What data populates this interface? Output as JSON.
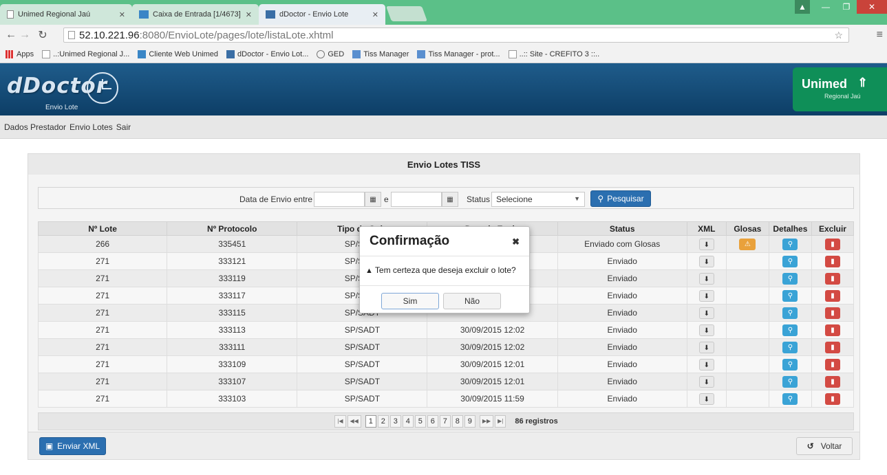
{
  "browser": {
    "tabs": [
      {
        "label": "Unimed Regional Jaú",
        "active": false
      },
      {
        "label": "Caixa de Entrada [1/4673]",
        "active": false
      },
      {
        "label": "dDoctor - Envio Lote",
        "active": true
      }
    ],
    "url_host": "52.10.221.96",
    "url_path": ":8080/EnvioLote/pages/lote/listaLote.xhtml",
    "bookmarks": [
      "Apps",
      "..:Unimed Regional J...",
      "Cliente Web Unimed",
      "dDoctor - Envio Lot...",
      "GED",
      "Tiss Manager",
      "Tiss Manager - prot...",
      "..:: Site - CREFITO 3 ::.."
    ]
  },
  "header": {
    "logo": "dDoctor",
    "logo_sub": "Envio Lote",
    "partner": "Unimed",
    "partner_sub": "Regional Jaú"
  },
  "menu": [
    "Dados Prestador",
    "Envio Lotes",
    "Sair"
  ],
  "panel": {
    "title": "Envio Lotes TISS",
    "filter": {
      "date_label": "Data de Envio entre",
      "and_label": "e",
      "status_label": "Status",
      "status_value": "Selecione",
      "search_button": "Pesquisar"
    },
    "columns": [
      "Nº Lote",
      "Nº Protocolo",
      "Tipo de Guia",
      "Data de Envio",
      "Status",
      "XML",
      "Glosas",
      "Detalhes",
      "Excluir"
    ],
    "rows": [
      {
        "lote": "266",
        "protocolo": "335451",
        "tipo": "SP/SADT",
        "data": "",
        "status": "Enviado com Glosas"
      },
      {
        "lote": "271",
        "protocolo": "333121",
        "tipo": "SP/SADT",
        "data": "",
        "status": "Enviado"
      },
      {
        "lote": "271",
        "protocolo": "333119",
        "tipo": "SP/SADT",
        "data": "",
        "status": "Enviado"
      },
      {
        "lote": "271",
        "protocolo": "333117",
        "tipo": "SP/SADT",
        "data": "",
        "status": "Enviado"
      },
      {
        "lote": "271",
        "protocolo": "333115",
        "tipo": "SP/SADT",
        "data": "",
        "status": "Enviado"
      },
      {
        "lote": "271",
        "protocolo": "333113",
        "tipo": "SP/SADT",
        "data": "30/09/2015 12:02",
        "status": "Enviado"
      },
      {
        "lote": "271",
        "protocolo": "333111",
        "tipo": "SP/SADT",
        "data": "30/09/2015 12:02",
        "status": "Enviado"
      },
      {
        "lote": "271",
        "protocolo": "333109",
        "tipo": "SP/SADT",
        "data": "30/09/2015 12:01",
        "status": "Enviado"
      },
      {
        "lote": "271",
        "protocolo": "333107",
        "tipo": "SP/SADT",
        "data": "30/09/2015 12:01",
        "status": "Enviado"
      },
      {
        "lote": "271",
        "protocolo": "333103",
        "tipo": "SP/SADT",
        "data": "30/09/2015 11:59",
        "status": "Enviado"
      }
    ],
    "pager": {
      "pages": [
        "1",
        "2",
        "3",
        "4",
        "5",
        "6",
        "7",
        "8",
        "9"
      ],
      "current": "1",
      "total": "86 registros"
    },
    "footer": {
      "send_button": "Enviar XML",
      "back_button": "Voltar"
    }
  },
  "modal": {
    "title": "Confirmação",
    "message": "Tem certeza que deseja excluir o lote?",
    "yes": "Sim",
    "no": "Não"
  },
  "colors": {
    "browser_frame": "#5bc088",
    "header_blue": "#1f5c8b",
    "primary": "#2b6fb0",
    "unimed_green": "#0f8f58",
    "warn": "#e9a13b",
    "info": "#3aa3d6",
    "danger": "#d34a43"
  }
}
